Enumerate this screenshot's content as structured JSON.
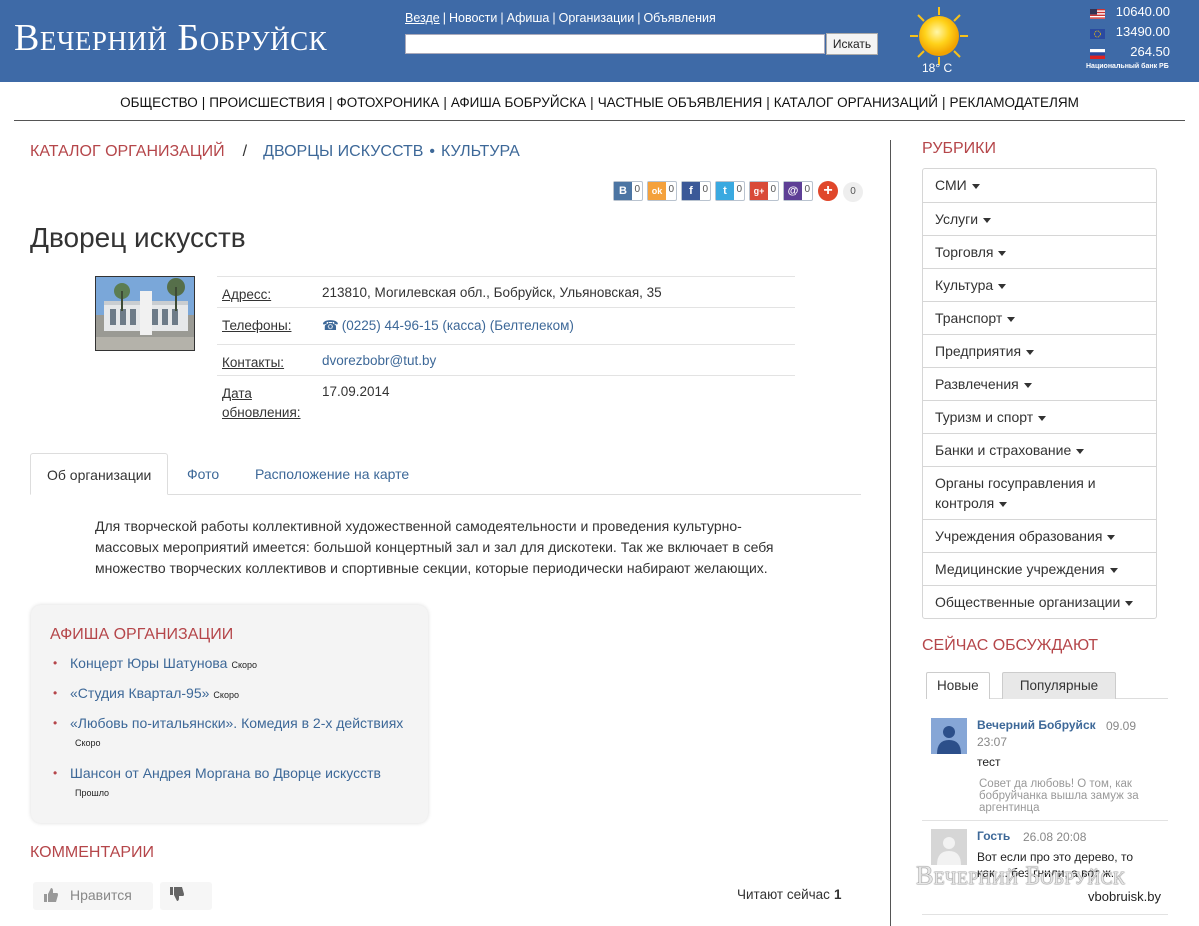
{
  "header": {
    "logo_text": "Вечерний Бобруйск",
    "top_links": [
      "Везде",
      "Новости",
      "Афиша",
      "Организации",
      "Объявления"
    ],
    "search_button": "Искать",
    "search_value": "",
    "weather": {
      "temperature": "18° C",
      "icon": "sun-icon"
    },
    "rates": [
      {
        "flag": "us-flag-icon",
        "value": "10640.00"
      },
      {
        "flag": "eu-flag-icon",
        "value": "13490.00"
      },
      {
        "flag": "ru-flag-icon",
        "value": "264.50"
      }
    ],
    "rates_note": "Национальный банк РБ"
  },
  "nav": [
    "ОБЩЕСТВО",
    "ПРОИСШЕСТВИЯ",
    "ФОТОХРОНИКА",
    "АФИША БОБРУЙСКА",
    "ЧАСТНЫЕ ОБЪЯВЛЕНИЯ",
    "КАТАЛОГ ОРГАНИЗАЦИЙ",
    "РЕКЛАМОДАТЕЛЯМ"
  ],
  "breadcrumb": {
    "catalog": "КАТАЛОГ ОРГАНИЗАЦИЙ",
    "slash": "/",
    "palaces": "ДВОРЦЫ ИСКУССТВ",
    "dot": "•",
    "culture": "КУЛЬТУРА"
  },
  "share": [
    {
      "icon": "vk-icon",
      "glyph": "B",
      "color": "#4c75a3",
      "count": "0"
    },
    {
      "icon": "odnoklassniki-icon",
      "glyph": "ok",
      "color": "#f4a13c",
      "count": "0"
    },
    {
      "icon": "facebook-icon",
      "glyph": "f",
      "color": "#3b5998",
      "count": "0"
    },
    {
      "icon": "twitter-icon",
      "glyph": "t",
      "color": "#3aa9e0",
      "count": "0"
    },
    {
      "icon": "google-plus-icon",
      "glyph": "g+",
      "color": "#d94a38",
      "count": "0"
    },
    {
      "icon": "mail-icon",
      "glyph": "@",
      "color": "#5e3f96",
      "count": "0"
    }
  ],
  "share_total": "0",
  "org": {
    "title": "Дворец искусств",
    "address_label": "Адресс:",
    "address": "213810, Могилевская обл., Бобруйск, Ульяновская, 35",
    "phones_label": "Телефоны:",
    "phone": "(0225) 44-96-15 (касса) (Белтелеком)",
    "contacts_label": "Контакты:",
    "email": "dvorezbobr@tut.by",
    "updated_label": "Дата обновления:",
    "updated": "17.09.2014"
  },
  "tabs": [
    "Об организации",
    "Фото",
    "Расположение на карте"
  ],
  "about": "Для творческой работы коллективной художественной самодеятельности и проведения культурно-массовых мероприятий имеется: большой концертный зал и зал для дискотеки. Так же включает в себя множество творческих коллективов и спортивные секции, которые периодически набирают желающих.",
  "afisha": {
    "title": "Афиша организации",
    "items": [
      {
        "title": "Концерт Юры Шатунова",
        "status": "Скоро"
      },
      {
        "title": "«Студия Квартал-95»",
        "status": "Скоро"
      },
      {
        "title": "«Любовь по-итальянски». Комедия в 2-х действиях",
        "status": "Скоро"
      },
      {
        "title": "Шансон от Андрея Моргана во Дворце искусств",
        "status": "Прошло"
      }
    ]
  },
  "comments": {
    "title": "Комментарии",
    "like_label": "Нравится",
    "reading_label": "Читают сейчас",
    "reading_count": "1"
  },
  "sidebar": {
    "rubrics_title": "Рубрики",
    "rubrics": [
      "СМИ",
      "Услуги",
      "Торговля",
      "Культура",
      "Транспорт",
      "Предприятия",
      "Развлечения",
      "Туризм и спорт",
      "Банки и страхование",
      "Органы госуправления и контроля",
      "Учреждения образования",
      "Медицинские учреждения",
      "Общественные организации"
    ],
    "discuss_title": "Сейчас обсуждают",
    "discuss_tabs": [
      "Новые",
      "Популярные"
    ],
    "discussions": [
      {
        "author": "Вечерний Бобруйск",
        "date": "09.09",
        "time": "23:07",
        "text": "тест",
        "quote": "Совет да любовь! О том, как бобруйчанка вышла замуж за аргентинца"
      },
      {
        "author": "Гость",
        "date": "26.08 20:08",
        "text": "Вот если про это дерево, то как ... без гнили, а вот ж..."
      }
    ]
  },
  "watermark": {
    "logo": "Вечерний Бобруйск",
    "url": "vbobruisk.by"
  },
  "colors": {
    "header_bg": "#3e6aa7",
    "accent_red": "#b5464a",
    "link_blue": "#3d6898"
  }
}
